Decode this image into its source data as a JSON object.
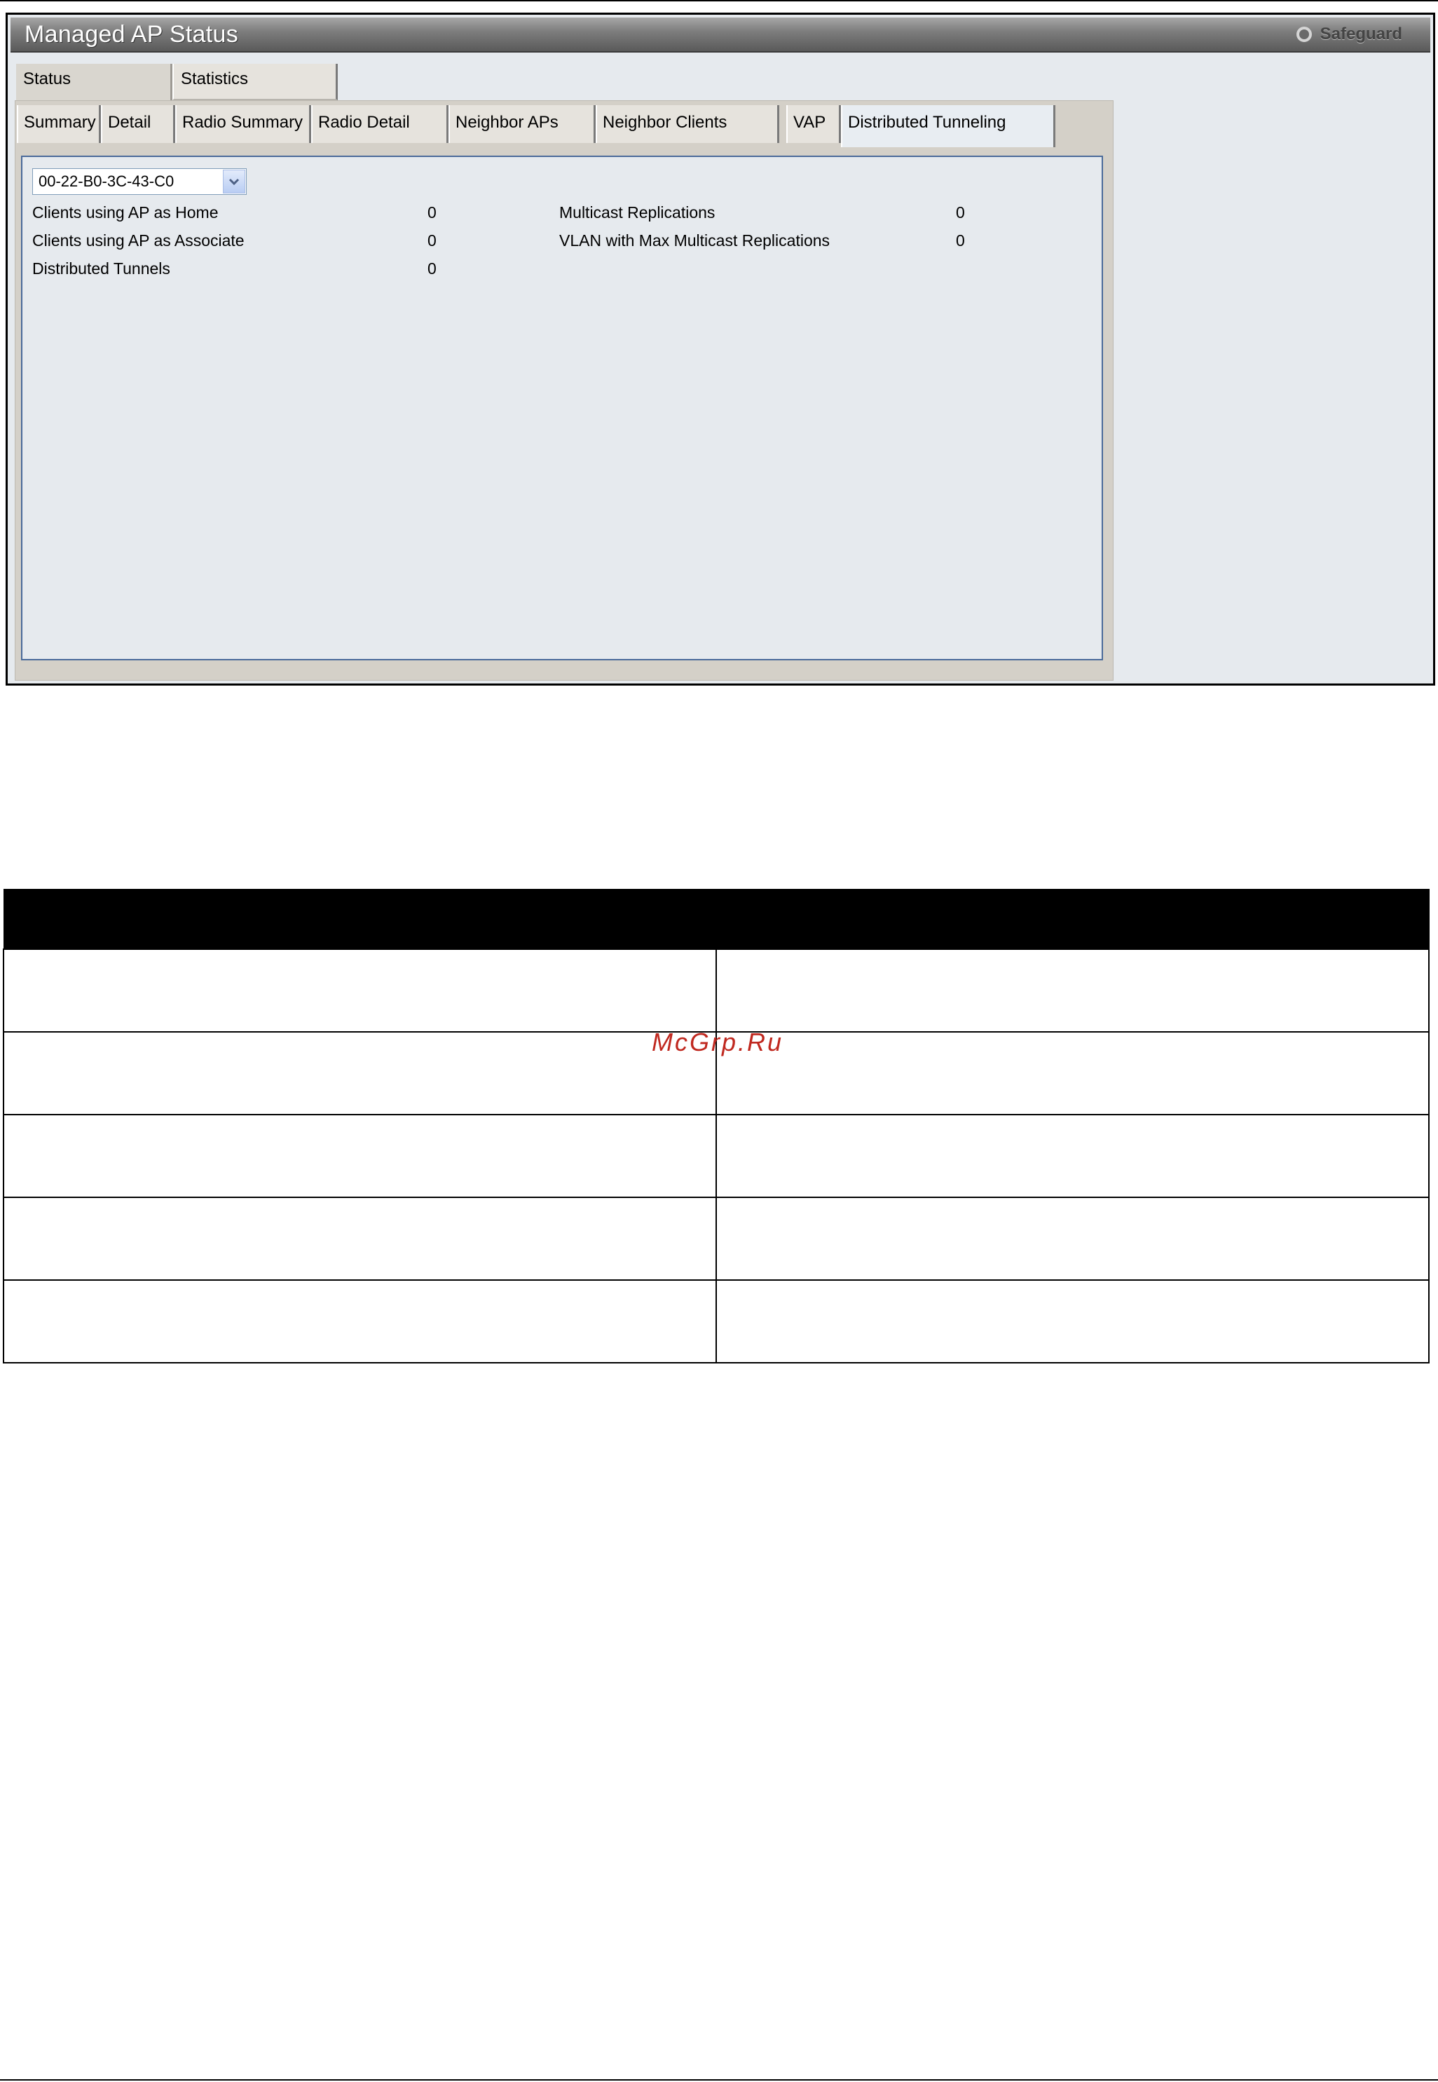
{
  "window": {
    "title": "Managed AP Status",
    "brand_label": "Safeguard"
  },
  "outer_tabs": [
    {
      "label": "Status",
      "active": true
    },
    {
      "label": "Statistics",
      "active": false
    }
  ],
  "sub_tabs": [
    {
      "label": "Summary",
      "active": false
    },
    {
      "label": "Detail",
      "active": false
    },
    {
      "label": "Radio Summary",
      "active": false
    },
    {
      "label": "Radio Detail",
      "active": false
    },
    {
      "label": "Neighbor APs",
      "active": false
    },
    {
      "label": "Neighbor Clients",
      "active": false
    },
    {
      "label": "VAP",
      "active": false
    },
    {
      "label": "Distributed Tunneling",
      "active": true
    }
  ],
  "ap_select": {
    "value": "00-22-B0-3C-43-C0"
  },
  "stats_left": [
    {
      "label": "Clients using AP as Home",
      "value": "0"
    },
    {
      "label": "Clients using AP as Associate",
      "value": "0"
    },
    {
      "label": "Distributed Tunnels",
      "value": "0"
    }
  ],
  "stats_right": [
    {
      "label": "Multicast Replications",
      "value": "0"
    },
    {
      "label": "VLAN with Max Multicast Replications",
      "value": "0"
    }
  ],
  "table": {
    "header": [
      "",
      ""
    ],
    "rows": [
      [
        "",
        ""
      ],
      [
        "",
        ""
      ],
      [
        "",
        ""
      ],
      [
        "",
        ""
      ],
      [
        "",
        ""
      ]
    ]
  },
  "watermark": "McGrp.Ru",
  "colors": {
    "title_bar": "#6e6e6e",
    "content_border": "#4a6a9a",
    "watermark": "#c0281f"
  }
}
